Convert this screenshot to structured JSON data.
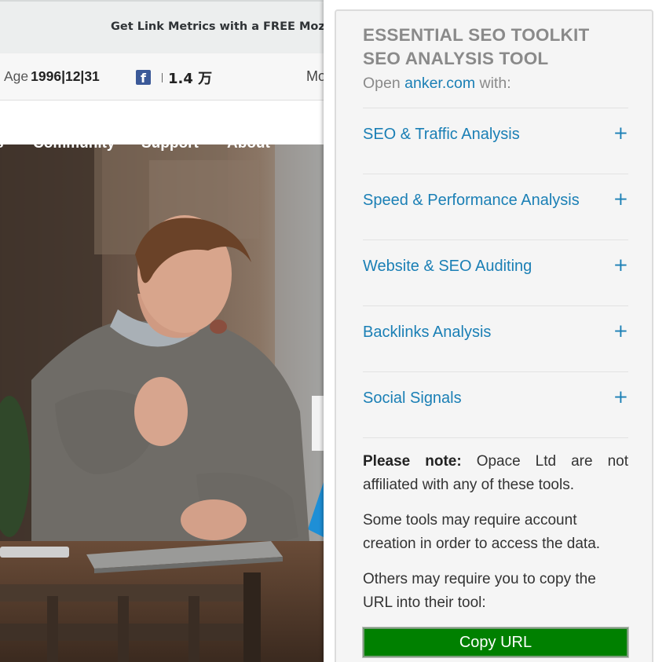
{
  "site": {
    "banner_text": "Get Link Metrics with a FREE Moz Co",
    "metrics": {
      "age_label": "Age",
      "age_value": "1996|12|31",
      "facebook_icon": "f",
      "facebook_count": "1.4 万",
      "more_text": "Mo"
    },
    "nav": [
      "s",
      "Community",
      "Support",
      "About"
    ]
  },
  "panel": {
    "title_line1": "ESSENTIAL SEO TOOLKIT",
    "title_line2": "SEO ANALYSIS TOOL",
    "open_prefix": "Open",
    "open_domain": "anker.com",
    "open_suffix": "with:",
    "sections": [
      {
        "label": "SEO & Traffic Analysis",
        "icon": "+"
      },
      {
        "label": "Speed & Performance Analysis",
        "icon": "+"
      },
      {
        "label": "Website & SEO Auditing",
        "icon": "+"
      },
      {
        "label": "Backlinks Analysis",
        "icon": "+"
      },
      {
        "label": "Social Signals",
        "icon": "+"
      }
    ],
    "note_label": "Please note:",
    "note_text": "Opace Ltd are not affiliated with any of these tools.",
    "account_note": "Some tools may require account creation in order to access the data.",
    "copy_note": "Others may require you to copy the URL into their tool:",
    "copy_button": "Copy URL"
  },
  "colors": {
    "accent": "#1a7fb5",
    "heading_gray": "#8a8a8a",
    "button_green": "#008000",
    "facebook_blue": "#3b5998"
  }
}
